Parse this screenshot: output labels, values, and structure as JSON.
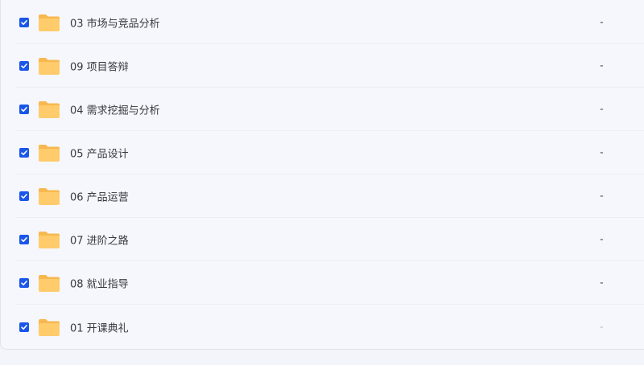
{
  "colors": {
    "checkbox": "#1a56e8",
    "folder_body": "#ffcb6b",
    "folder_tab": "#f7b84f"
  },
  "files": [
    {
      "name": "03 市场与竞品分析",
      "size": "-",
      "checked": true
    },
    {
      "name": "09 项目答辩",
      "size": "-",
      "checked": true
    },
    {
      "name": "04 需求挖掘与分析",
      "size": "-",
      "checked": true
    },
    {
      "name": "05 产品设计",
      "size": "-",
      "checked": true
    },
    {
      "name": "06 产品运营",
      "size": "-",
      "checked": true
    },
    {
      "name": "07 进阶之路",
      "size": "-",
      "checked": true
    },
    {
      "name": "08 就业指导",
      "size": "-",
      "checked": true
    },
    {
      "name": "01 开课典礼",
      "size": "-",
      "checked": true
    }
  ]
}
